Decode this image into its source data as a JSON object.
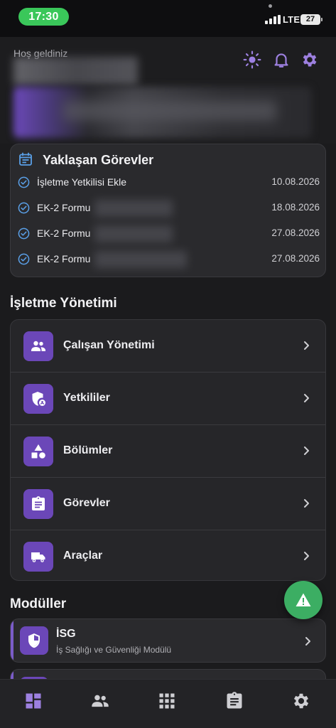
{
  "status_bar": {
    "time": "17:30",
    "network": "LTE",
    "battery": "27"
  },
  "header": {
    "welcome": "Hoş geldiniz"
  },
  "upcoming_tasks": {
    "title": "Yaklaşan Görevler",
    "items": [
      {
        "name": "İşletme Yetkilisi Ekle",
        "date": "10.08.2026"
      },
      {
        "name": "EK-2 Formu",
        "date": "18.08.2026"
      },
      {
        "name": "EK-2 Formu",
        "date": "27.08.2026"
      },
      {
        "name": "EK-2 Formu",
        "date": "27.08.2026"
      }
    ]
  },
  "management": {
    "title": "İşletme Yönetimi",
    "items": [
      {
        "label": "Çalışan Yönetimi",
        "icon": "people-icon"
      },
      {
        "label": "Yetkililer",
        "icon": "admin-shield-icon"
      },
      {
        "label": "Bölümler",
        "icon": "category-shapes-icon"
      },
      {
        "label": "Görevler",
        "icon": "clipboard-icon"
      },
      {
        "label": "Araçlar",
        "icon": "truck-icon"
      }
    ]
  },
  "modules": {
    "title": "Modüller",
    "items": [
      {
        "title": "İSG",
        "subtitle": "İş Sağlığı ve Güvenliği Modülü",
        "icon": "shield-icon"
      }
    ]
  },
  "bottom_nav": [
    "dashboard-icon",
    "people-icon",
    "apps-grid-icon",
    "clipboard-icon",
    "gear-icon"
  ],
  "colors": {
    "accent": "#6b47b8",
    "accent_light": "#9d80e0",
    "fab": "#3cae63",
    "status_pill": "#3ac75a",
    "check_blue": "#5aa0e8",
    "background": "#1b1b1d"
  }
}
